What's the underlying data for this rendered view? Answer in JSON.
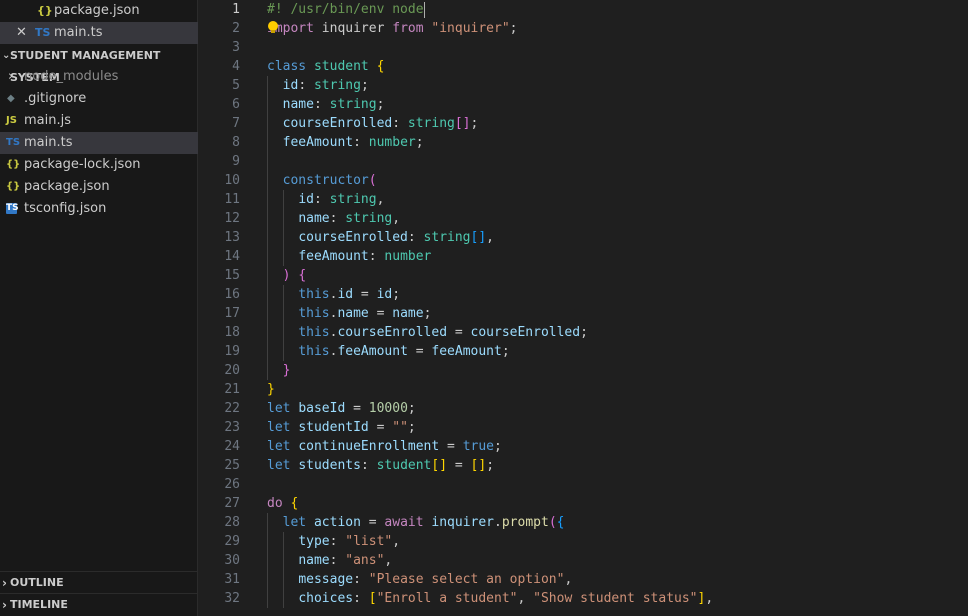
{
  "open_editors": [
    {
      "icon": "{}",
      "label": "package.json",
      "active": false,
      "close": false
    },
    {
      "icon": "TS",
      "label": "main.ts",
      "active": true,
      "close": true
    }
  ],
  "explorer": {
    "title": "STUDENT MANAGEMENT SYSTEM",
    "items": [
      {
        "icon": "›",
        "label": "node_modules",
        "muted": true,
        "kind": "folder"
      },
      {
        "icon": "◆",
        "label": ".gitignore",
        "muted": false,
        "kind": "git"
      },
      {
        "icon": "JS",
        "label": "main.js",
        "muted": false,
        "kind": "js"
      },
      {
        "icon": "TS",
        "label": "main.ts",
        "muted": false,
        "kind": "ts",
        "active": true
      },
      {
        "icon": "{}",
        "label": "package-lock.json",
        "muted": false,
        "kind": "json"
      },
      {
        "icon": "{}",
        "label": "package.json",
        "muted": false,
        "kind": "json"
      },
      {
        "icon": "TS",
        "label": "tsconfig.json",
        "muted": false,
        "kind": "tsconfig"
      }
    ]
  },
  "panels": {
    "outline": "OUTLINE",
    "timeline": "TIMELINE"
  },
  "colors": {
    "json_icon": "#cbcb41",
    "ts_icon": "#3178c6",
    "js_icon": "#cbcb41",
    "git_icon": "#6d8086"
  },
  "code_lines": [
    {
      "n": "1",
      "tokens": [
        [
          "cmt",
          "#! /usr/bin/env node"
        ]
      ],
      "cursor": true
    },
    {
      "n": "2",
      "tokens": [
        [
          "ctrl",
          "import"
        ],
        [
          "",
          " inquirer "
        ],
        [
          "ctrl",
          "from"
        ],
        [
          "",
          " "
        ],
        [
          "str",
          "\"inquirer\""
        ],
        [
          "",
          ";"
        ]
      ]
    },
    {
      "n": "3",
      "tokens": []
    },
    {
      "n": "4",
      "tokens": [
        [
          "kw",
          "class"
        ],
        [
          "",
          " "
        ],
        [
          "cls",
          "student"
        ],
        [
          "",
          " "
        ],
        [
          "br1",
          "{"
        ]
      ]
    },
    {
      "n": "5",
      "tokens": [
        [
          "",
          "  "
        ],
        [
          "prop",
          "id"
        ],
        [
          "",
          ": "
        ],
        [
          "cls",
          "string"
        ],
        [
          "",
          ";"
        ]
      ]
    },
    {
      "n": "6",
      "tokens": [
        [
          "",
          "  "
        ],
        [
          "prop",
          "name"
        ],
        [
          "",
          ": "
        ],
        [
          "cls",
          "string"
        ],
        [
          "",
          ";"
        ]
      ]
    },
    {
      "n": "7",
      "tokens": [
        [
          "",
          "  "
        ],
        [
          "prop",
          "courseEnrolled"
        ],
        [
          "",
          ": "
        ],
        [
          "cls",
          "string"
        ],
        [
          "br2",
          "[]"
        ],
        [
          "",
          ";"
        ]
      ]
    },
    {
      "n": "8",
      "tokens": [
        [
          "",
          "  "
        ],
        [
          "prop",
          "feeAmount"
        ],
        [
          "",
          ": "
        ],
        [
          "cls",
          "number"
        ],
        [
          "",
          ";"
        ]
      ]
    },
    {
      "n": "9",
      "tokens": []
    },
    {
      "n": "10",
      "tokens": [
        [
          "",
          "  "
        ],
        [
          "kw",
          "constructor"
        ],
        [
          "br2",
          "("
        ]
      ]
    },
    {
      "n": "11",
      "tokens": [
        [
          "",
          "    "
        ],
        [
          "prop",
          "id"
        ],
        [
          "",
          ": "
        ],
        [
          "cls",
          "string"
        ],
        [
          "",
          ","
        ]
      ]
    },
    {
      "n": "12",
      "tokens": [
        [
          "",
          "    "
        ],
        [
          "prop",
          "name"
        ],
        [
          "",
          ": "
        ],
        [
          "cls",
          "string"
        ],
        [
          "",
          ","
        ]
      ]
    },
    {
      "n": "13",
      "tokens": [
        [
          "",
          "    "
        ],
        [
          "prop",
          "courseEnrolled"
        ],
        [
          "",
          ": "
        ],
        [
          "cls",
          "string"
        ],
        [
          "br3",
          "[]"
        ],
        [
          "",
          ","
        ]
      ]
    },
    {
      "n": "14",
      "tokens": [
        [
          "",
          "    "
        ],
        [
          "prop",
          "feeAmount"
        ],
        [
          "",
          ": "
        ],
        [
          "cls",
          "number"
        ]
      ]
    },
    {
      "n": "15",
      "tokens": [
        [
          "",
          "  "
        ],
        [
          "br2",
          ")"
        ],
        [
          "",
          " "
        ],
        [
          "br2",
          "{"
        ]
      ]
    },
    {
      "n": "16",
      "tokens": [
        [
          "",
          "    "
        ],
        [
          "kw",
          "this"
        ],
        [
          "",
          "."
        ],
        [
          "prop",
          "id"
        ],
        [
          "",
          " = "
        ],
        [
          "prop",
          "id"
        ],
        [
          "",
          ";"
        ]
      ]
    },
    {
      "n": "17",
      "tokens": [
        [
          "",
          "    "
        ],
        [
          "kw",
          "this"
        ],
        [
          "",
          "."
        ],
        [
          "prop",
          "name"
        ],
        [
          "",
          " = "
        ],
        [
          "prop",
          "name"
        ],
        [
          "",
          ";"
        ]
      ]
    },
    {
      "n": "18",
      "tokens": [
        [
          "",
          "    "
        ],
        [
          "kw",
          "this"
        ],
        [
          "",
          "."
        ],
        [
          "prop",
          "courseEnrolled"
        ],
        [
          "",
          " = "
        ],
        [
          "prop",
          "courseEnrolled"
        ],
        [
          "",
          ";"
        ]
      ]
    },
    {
      "n": "19",
      "tokens": [
        [
          "",
          "    "
        ],
        [
          "kw",
          "this"
        ],
        [
          "",
          "."
        ],
        [
          "prop",
          "feeAmount"
        ],
        [
          "",
          " = "
        ],
        [
          "prop",
          "feeAmount"
        ],
        [
          "",
          ";"
        ]
      ]
    },
    {
      "n": "20",
      "tokens": [
        [
          "",
          "  "
        ],
        [
          "br2",
          "}"
        ]
      ]
    },
    {
      "n": "21",
      "tokens": [
        [
          "br1",
          "}"
        ]
      ]
    },
    {
      "n": "22",
      "tokens": [
        [
          "kw",
          "let"
        ],
        [
          "",
          " "
        ],
        [
          "prop",
          "baseId"
        ],
        [
          "",
          " = "
        ],
        [
          "num",
          "10000"
        ],
        [
          "",
          ";"
        ]
      ]
    },
    {
      "n": "23",
      "tokens": [
        [
          "kw",
          "let"
        ],
        [
          "",
          " "
        ],
        [
          "prop",
          "studentId"
        ],
        [
          "",
          " = "
        ],
        [
          "str",
          "\"\""
        ],
        [
          "",
          ";"
        ]
      ]
    },
    {
      "n": "24",
      "tokens": [
        [
          "kw",
          "let"
        ],
        [
          "",
          " "
        ],
        [
          "prop",
          "continueEnrollment"
        ],
        [
          "",
          " = "
        ],
        [
          "kw",
          "true"
        ],
        [
          "",
          ";"
        ]
      ]
    },
    {
      "n": "25",
      "tokens": [
        [
          "kw",
          "let"
        ],
        [
          "",
          " "
        ],
        [
          "prop",
          "students"
        ],
        [
          "",
          ": "
        ],
        [
          "cls",
          "student"
        ],
        [
          "br1",
          "[]"
        ],
        [
          "",
          " = "
        ],
        [
          "br1",
          "[]"
        ],
        [
          "",
          ";"
        ]
      ]
    },
    {
      "n": "26",
      "tokens": []
    },
    {
      "n": "27",
      "tokens": [
        [
          "ctrl",
          "do"
        ],
        [
          "",
          " "
        ],
        [
          "br1",
          "{"
        ]
      ]
    },
    {
      "n": "28",
      "tokens": [
        [
          "",
          "  "
        ],
        [
          "kw",
          "let"
        ],
        [
          "",
          " "
        ],
        [
          "prop",
          "action"
        ],
        [
          "",
          " = "
        ],
        [
          "ctrl",
          "await"
        ],
        [
          "",
          " "
        ],
        [
          "prop",
          "inquirer"
        ],
        [
          "",
          "."
        ],
        [
          "fn",
          "prompt"
        ],
        [
          "br2",
          "("
        ],
        [
          "br3",
          "{"
        ]
      ]
    },
    {
      "n": "29",
      "tokens": [
        [
          "",
          "    "
        ],
        [
          "prop",
          "type"
        ],
        [
          "",
          ": "
        ],
        [
          "str",
          "\"list\""
        ],
        [
          "",
          ","
        ]
      ]
    },
    {
      "n": "30",
      "tokens": [
        [
          "",
          "    "
        ],
        [
          "prop",
          "name"
        ],
        [
          "",
          ": "
        ],
        [
          "str",
          "\"ans\""
        ],
        [
          "",
          ","
        ]
      ]
    },
    {
      "n": "31",
      "tokens": [
        [
          "",
          "    "
        ],
        [
          "prop",
          "message"
        ],
        [
          "",
          ": "
        ],
        [
          "str",
          "\"Please select an option\""
        ],
        [
          "",
          ","
        ]
      ]
    },
    {
      "n": "32",
      "tokens": [
        [
          "",
          "    "
        ],
        [
          "prop",
          "choices"
        ],
        [
          "",
          ": "
        ],
        [
          "br1",
          "["
        ],
        [
          "str",
          "\"Enroll a student\""
        ],
        [
          "",
          ", "
        ],
        [
          "str",
          "\"Show student status\""
        ],
        [
          "br1",
          "]"
        ],
        [
          "",
          ","
        ]
      ]
    }
  ]
}
